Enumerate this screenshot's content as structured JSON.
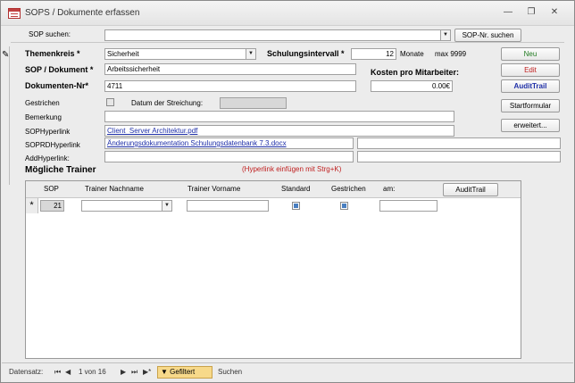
{
  "window": {
    "title": "SOPS / Dokumente erfassen"
  },
  "header": {
    "search_label": "SOP suchen:",
    "search_value": "",
    "search_button": "SOP-Nr. suchen"
  },
  "form": {
    "themenkreis_label": "Themenkreis *",
    "themenkreis_value": "Sicherheit",
    "schulungsintervall_label": "Schulungsintervall *",
    "schulungsintervall_value": "12",
    "monate_label": "Monate",
    "max_label": "max 9999",
    "sop_dokument_label": "SOP / Dokument *",
    "sop_dokument_value": "Arbeitssicherheit",
    "kosten_label": "Kosten pro Mitarbeiter:",
    "kosten_value": "0.00€",
    "dokumenten_nr_label": "Dokumenten-Nr*",
    "dokumenten_nr_value": "4711",
    "gestrichen_label": "Gestrichen",
    "datum_streichung_label": "Datum der Streichung:",
    "datum_streichung_value": "",
    "bemerkung_label": "Bemerkung",
    "bemerkung_value": "",
    "sop_hyperlink_label": "SOPHyperlink",
    "sop_hyperlink_value": "Client_Server Architektur.pdf",
    "sop_rd_hyperlink_label": "SOPRDHyperlink",
    "sop_rd_hyperlink_value": "Änderungsdokumentation Schulungsdatenbank 7.3.docx",
    "add_hyperlink_label": "AddHyperlink:",
    "add_hyperlink_value": "",
    "hyperlink_hint": "(Hyperlink einfügen mit Strg+K)"
  },
  "buttons": {
    "neu": "Neu",
    "edit": "Edit",
    "audit_trail": "AuditTrail",
    "startformular": "Startformular",
    "erweitert": "erweitert..."
  },
  "colors": {
    "neu_text": "#1f7a1f",
    "edit_text": "#c02020",
    "audit_text": "#1f2fa8",
    "hint_text": "#c02020",
    "filter_bg": "#f7d98a"
  },
  "trainer": {
    "section_title": "Mögliche Trainer",
    "columns": {
      "sop": "SOP",
      "nachname": "Trainer Nachname",
      "vorname": "Trainer Vorname",
      "standard": "Standard",
      "gestrichen": "Gestrichen",
      "am": "am:"
    },
    "audit_button": "AuditTrail",
    "new_row": {
      "marker": "*",
      "sop": "21",
      "nachname": "",
      "vorname": "",
      "standard": true,
      "gestrichen": true,
      "am": ""
    }
  },
  "statusbar": {
    "record_label": "Datensatz:",
    "first": "⏮",
    "prev": "◀",
    "position": "1 von 16",
    "next": "▶",
    "last": "⏭",
    "new": "▶*",
    "filter_label": "Gefiltert",
    "search_label": "Suchen"
  }
}
